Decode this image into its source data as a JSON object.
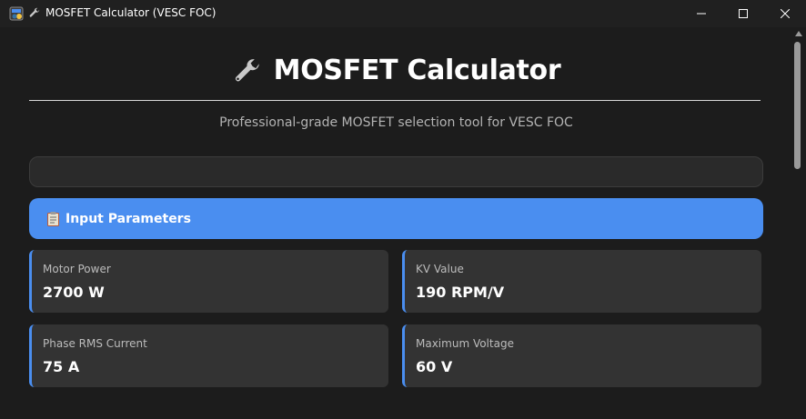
{
  "window": {
    "title": "MOSFET Calculator (VESC FOC)"
  },
  "header": {
    "title": "MOSFET Calculator",
    "subtitle": "Professional-grade MOSFET selection tool for VESC FOC"
  },
  "section": {
    "title": "Input Parameters"
  },
  "cards": [
    {
      "label": "Motor Power",
      "value": "2700 W"
    },
    {
      "label": "KV Value",
      "value": "190 RPM/V"
    },
    {
      "label": "Phase RMS Current",
      "value": "75 A"
    },
    {
      "label": "Maximum Voltage",
      "value": "60 V"
    }
  ],
  "colors": {
    "accent": "#4a8ef0",
    "background": "#1c1c1c",
    "card": "#333333",
    "titlebar": "#202020"
  },
  "icons": {
    "app": "python-app-icon",
    "title": "wrench-icon",
    "section": "clipboard-icon"
  }
}
